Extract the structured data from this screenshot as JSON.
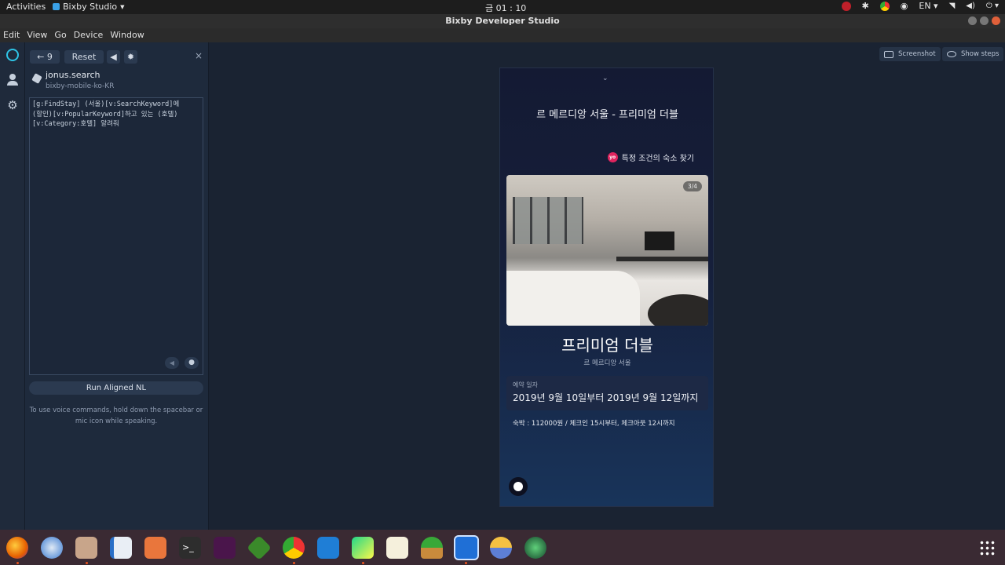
{
  "topbar": {
    "activities": "Activities",
    "app_menu": "Bixby Studio",
    "clock": "금 01 : 10",
    "lang": "EN"
  },
  "window": {
    "title": "Bixby Developer Studio"
  },
  "menubar": {
    "items": [
      "Edit",
      "View",
      "Go",
      "Device",
      "Window"
    ]
  },
  "panel": {
    "step_count": "9",
    "reset_label": "Reset",
    "capsule_name": "jonus.search",
    "capsule_target": "bixby-mobile-ko-KR",
    "aligned_nl": "[g:FindStay] (서울)[v:SearchKeyword]에\n(할인)[v:PopularKeyword]하고 있는 (호텔)\n[v:Category:호텔] 알려줘",
    "run_label": "Run Aligned NL",
    "voice_help": "To use voice commands, hold down the spacebar or mic icon while speaking."
  },
  "toolbar": {
    "screenshot_label": "Screenshot",
    "show_steps_label": "Show steps"
  },
  "phone": {
    "title": "르 메르디앙 서울 - 프리미엄 더블",
    "hint_badge": "yo",
    "hint": "특정 조건의 숙소 찾기",
    "photo_counter": "3/4",
    "room_name": "프리미엄 더블",
    "hotel_name": "르 메르디앙 서울",
    "booking_label": "예약 일자",
    "booking_dates": "2019년 9월 10일부터 2019년 9월 12일까지",
    "stay_info": "숙박 : 112000원 / 체크인 15시부터, 체크아웃 12시까지"
  },
  "colors": {
    "accent": "#e0245e",
    "panel_bg": "#1e2a3c",
    "main_bg": "#1a2332",
    "dock_bg": "#3a2a33"
  },
  "dock": {
    "apps": [
      "firefox-icon",
      "thunderbird-icon",
      "files-icon",
      "writer-icon",
      "software-icon",
      "terminal-icon",
      "slack-icon",
      "vim-icon",
      "chrome-icon",
      "vscode-icon",
      "pycharm-icon",
      "text-editor-icon",
      "palm-icon",
      "bixby-studio-icon",
      "weather-icon",
      "globe-icon",
      "show-apps-icon"
    ]
  }
}
